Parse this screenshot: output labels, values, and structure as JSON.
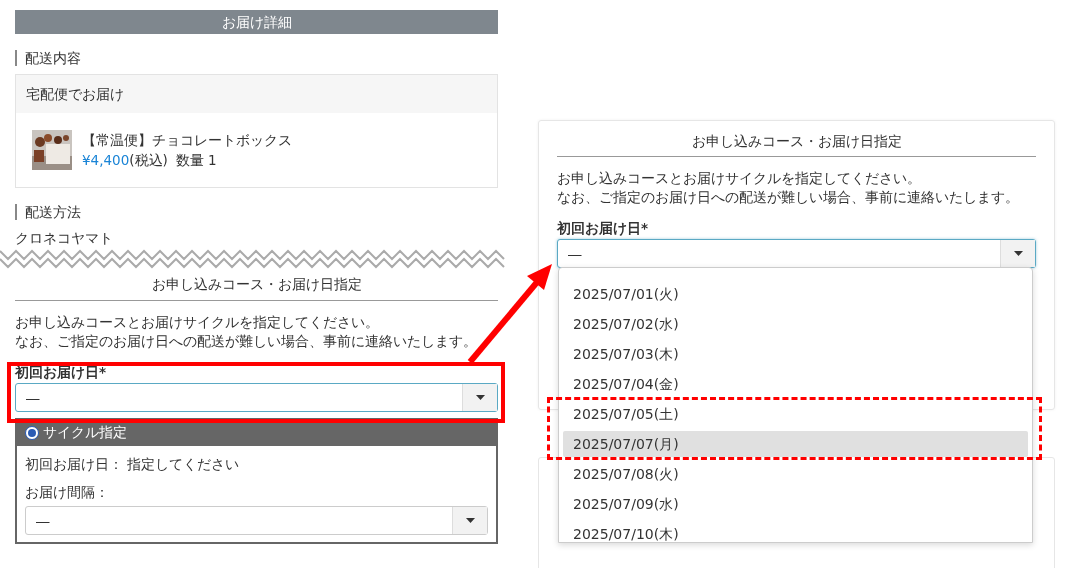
{
  "details": {
    "title": "お届け詳細",
    "contents_heading": "配送内容",
    "shipment": {
      "title": "宅配便でお届け",
      "product": {
        "kind": "picture",
        "name": "【常温便】チョコレートボックス",
        "price": "¥4,400",
        "tax": "(税込)",
        "quantity": "数量 1"
      }
    },
    "method_heading": "配送方法",
    "method": "クロネコヤマト"
  },
  "course_left": {
    "title": "お申し込みコース・お届け日指定",
    "lines": [
      "お申し込みコースとお届けサイクルを指定してください。",
      "なお、ご指定のお届け日への配送が難しい場合、事前に連絡いたします。"
    ],
    "first_date": {
      "label": "初回お届け日*",
      "value": "―",
      "expanded": false
    },
    "cycle": {
      "label": "サイクル指定",
      "selected": true,
      "first_date_text": "初回お届け日： 指定してください",
      "interval_label": "お届け間隔：",
      "interval_value": "―"
    }
  },
  "course_right": {
    "title": "お申し込みコース・お届け日指定",
    "lines": [
      "お申し込みコースとお届けサイクルを指定してください。",
      "なお、ご指定のお届け日への配送が難しい場合、事前に連絡いたします。"
    ],
    "first_date": {
      "label": "初回お届け日*",
      "value": "―",
      "expanded": true
    },
    "options": [
      {
        "label": "2025/07/01(火)",
        "selected": false
      },
      {
        "label": "2025/07/02(水)",
        "selected": false
      },
      {
        "label": "2025/07/03(木)",
        "selected": false
      },
      {
        "label": "2025/07/04(金)",
        "selected": false
      },
      {
        "label": "2025/07/05(土)",
        "selected": false
      },
      {
        "label": "2025/07/07(月)",
        "selected": true
      },
      {
        "label": "2025/07/08(火)",
        "selected": false
      },
      {
        "label": "2025/07/09(水)",
        "selected": false
      },
      {
        "label": "2025/07/10(木)",
        "selected": false
      }
    ]
  }
}
